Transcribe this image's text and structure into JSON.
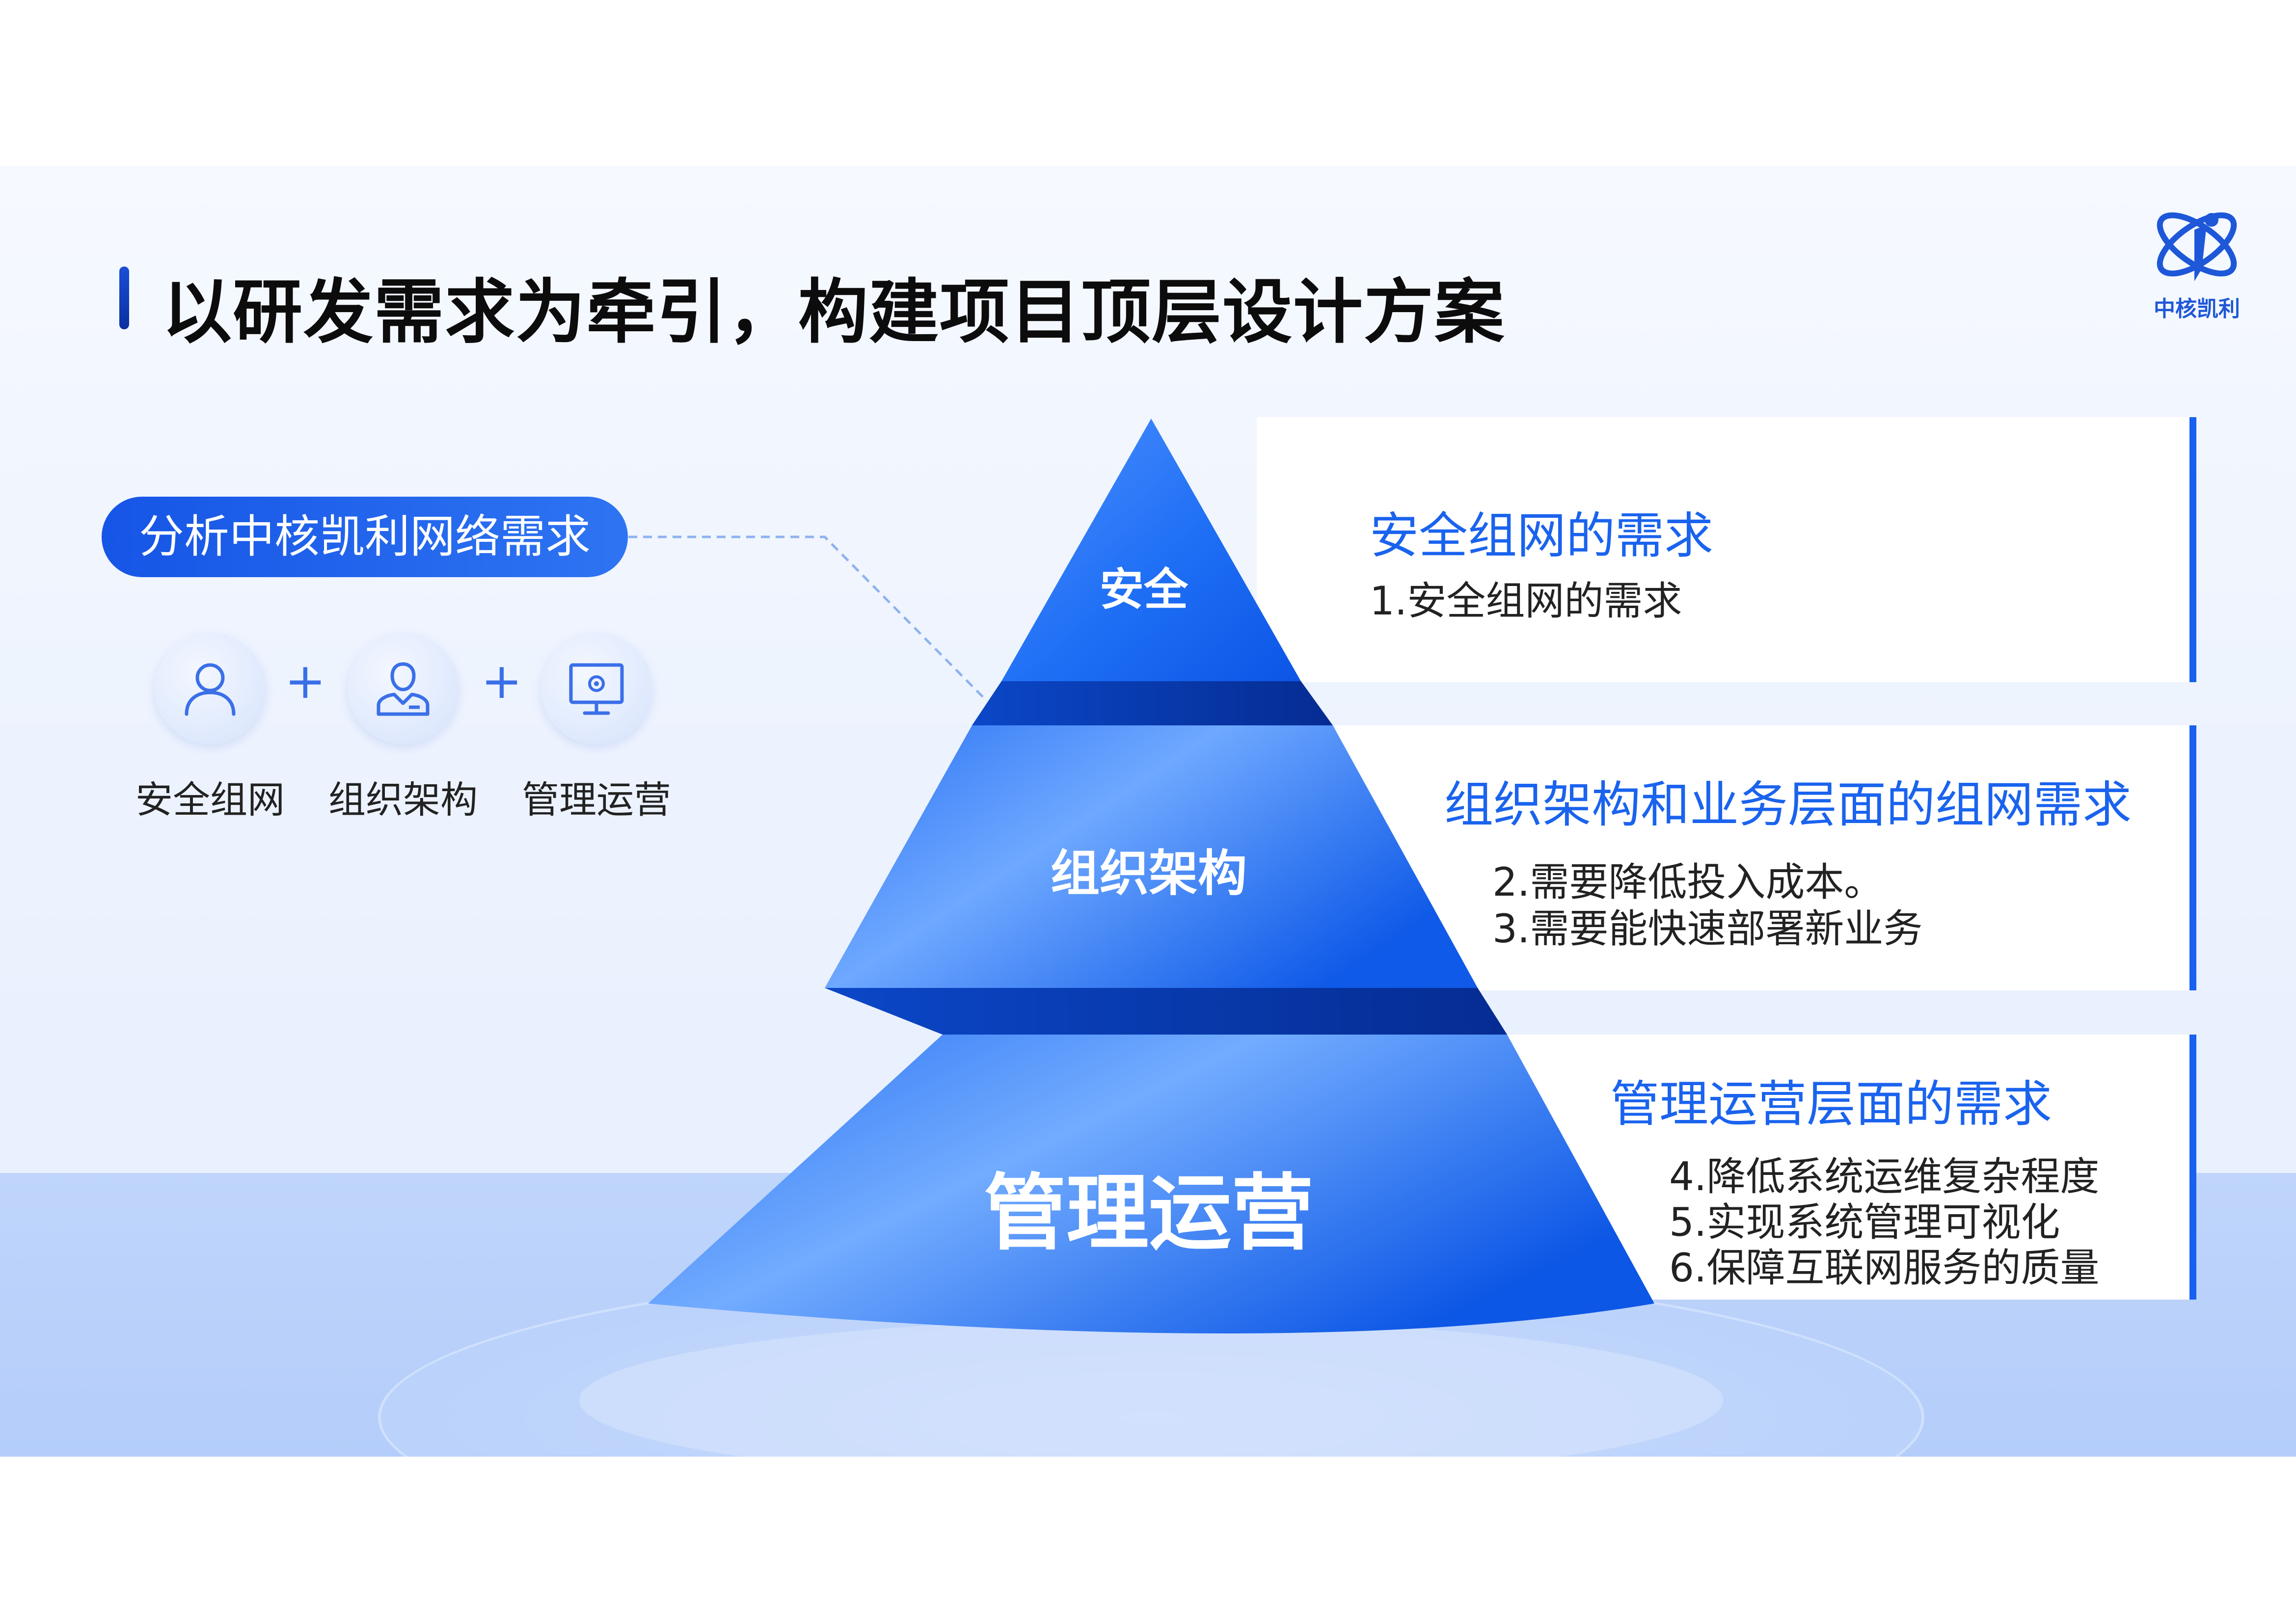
{
  "page": {
    "title": "以研发需求为牵引，构建项目顶层设计方案",
    "logo_text": "中核凯利"
  },
  "analysis": {
    "pill_label": "分析中核凯利网络需求",
    "icons": [
      {
        "icon": "user-icon",
        "label": "安全组网"
      },
      {
        "icon": "org-user-icon",
        "label": "组织架构"
      },
      {
        "icon": "monitor-gear-icon",
        "label": "管理运营"
      }
    ],
    "plus": "+"
  },
  "pyramid": {
    "tiers": [
      {
        "label": "安全"
      },
      {
        "label": "组织架构"
      },
      {
        "label": "管理运营"
      }
    ]
  },
  "panels": [
    {
      "title": "安全组网的需求",
      "items": [
        "1.安全组网的需求"
      ]
    },
    {
      "title": "组织架构和业务层面的组网需求",
      "items": [
        "2.需要降低投入成本。",
        "3.需要能快速部署新业务"
      ]
    },
    {
      "title": "管理运营层面的需求",
      "items": [
        "4.降低系统运维复杂程度",
        "5.实现系统管理可视化",
        "6.保障互联网服务的质量"
      ]
    }
  ],
  "colors": {
    "accent": "#1a63ee",
    "pyramid_light": "#66a3ff",
    "pyramid_dark": "#0a3fb8",
    "title_bar": "#1a4fd6"
  }
}
